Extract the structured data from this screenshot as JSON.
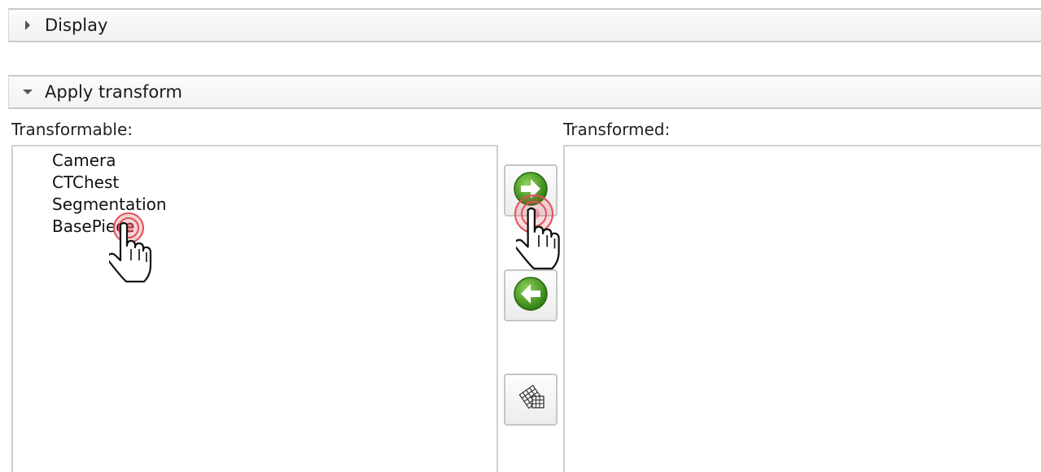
{
  "sections": {
    "display": {
      "label": "Display",
      "expanded": false
    },
    "apply_transform": {
      "label": "Apply transform",
      "expanded": true
    }
  },
  "transformable": {
    "label": "Transformable:",
    "items": [
      "Camera",
      "CTChest",
      "Segmentation",
      "BasePiece"
    ]
  },
  "transformed": {
    "label": "Transformed:",
    "items": []
  },
  "buttons": {
    "move_right_icon": "green-right-arrow-icon",
    "move_left_icon": "green-left-arrow-icon",
    "edit_icon": "grid-matrix-icon"
  },
  "colors": {
    "arrow_green": "#3f9b1c",
    "click_ring": "#e0505a",
    "border": "#c9c9c9"
  }
}
